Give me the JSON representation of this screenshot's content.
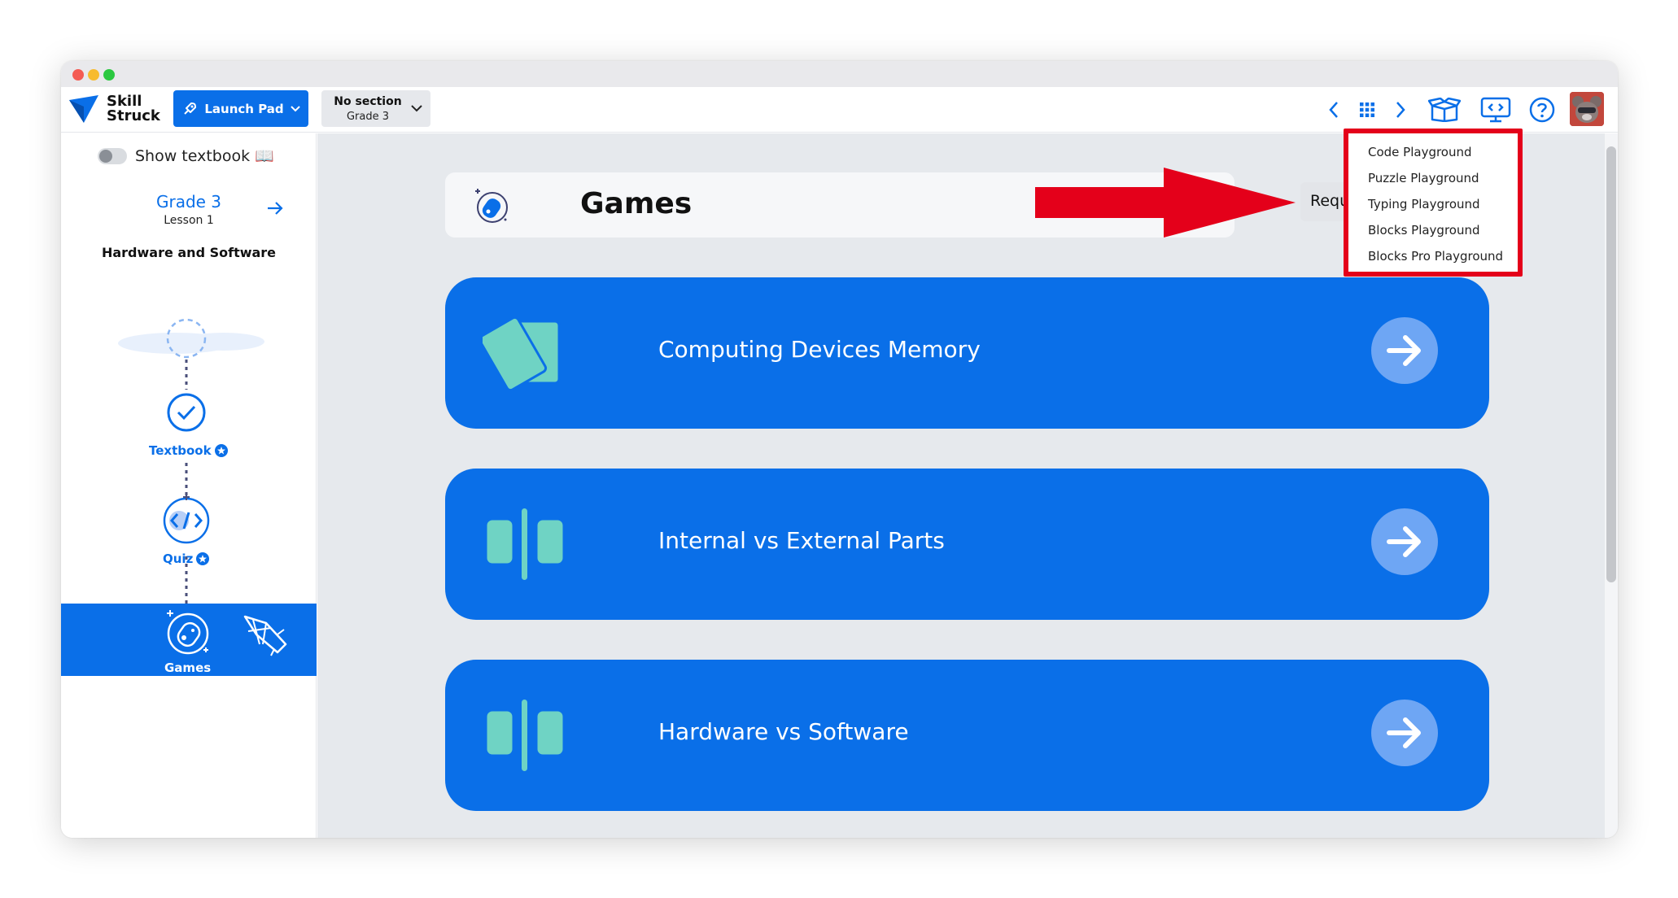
{
  "logo": {
    "line1": "Skill",
    "line2": "Struck"
  },
  "topbar": {
    "launch_pad_label": "Launch Pad",
    "section_line1": "No section",
    "section_line2": "Grade 3",
    "icons": [
      "chevron-left-icon",
      "apps-grid-icon",
      "chevron-right-icon",
      "box-icon",
      "present-screen-icon",
      "help-icon",
      "avatar"
    ]
  },
  "sidebar": {
    "show_textbook_label": "Show textbook 📖",
    "grade_title": "Grade 3",
    "lesson_label": "Lesson 1",
    "lesson_name": "Hardware and Software",
    "nodes": [
      {
        "label": "Textbook",
        "state": "complete"
      },
      {
        "label": "Quiz",
        "state": "star"
      },
      {
        "label": "Games",
        "state": "active"
      }
    ]
  },
  "main": {
    "header_title": "Games",
    "request_button_label": "Requ",
    "cards": [
      {
        "title": "Computing Devices Memory",
        "icon": "memory-cards-icon"
      },
      {
        "title": "Internal vs External Parts",
        "icon": "split-panels-icon"
      },
      {
        "title": "Hardware vs Software",
        "icon": "split-panels-icon"
      }
    ]
  },
  "dropdown": {
    "items": [
      "Code Playground",
      "Puzzle Playground",
      "Typing Playground",
      "Blocks Playground",
      "Blocks Pro Playground"
    ]
  },
  "colors": {
    "primary": "#0a6fe8",
    "card_arrow": "#6ea6f4",
    "teal": "#6fd3c4",
    "highlight_red": "#e4001a",
    "main_bg": "#e6e9ed"
  }
}
